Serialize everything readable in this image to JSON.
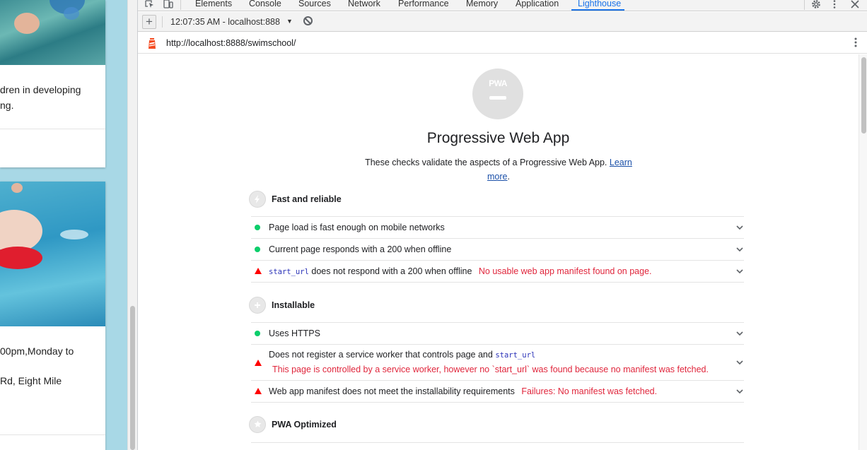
{
  "website": {
    "card1_lines": [
      "dren in developing",
      "ng."
    ],
    "card2_lines": [
      "00pm,Monday to",
      "Rd, Eight Mile"
    ]
  },
  "devtools": {
    "tabs": [
      "Elements",
      "Console",
      "Sources",
      "Network",
      "Performance",
      "Memory",
      "Application",
      "Lighthouse"
    ],
    "active_tab": "Lighthouse",
    "report_selector": "12:07:35 AM - localhost:888",
    "url": "http://localhost:8888/swimschool/"
  },
  "report": {
    "badge_text": "PWA",
    "title": "Progressive Web App",
    "description": "These checks validate the aspects of a Progressive Web App.",
    "learn_more": "Learn more",
    "groups": [
      {
        "title": "Fast and reliable",
        "audits": [
          {
            "status": "pass",
            "title": "Page load is fast enough on mobile networks"
          },
          {
            "status": "pass",
            "title": "Current page responds with a 200 when offline"
          },
          {
            "status": "fail",
            "code": "start_url",
            "title": "does not respond with a 200 when offline",
            "error": "No usable web app manifest found on page."
          }
        ]
      },
      {
        "title": "Installable",
        "audits": [
          {
            "status": "pass",
            "title": "Uses HTTPS"
          },
          {
            "status": "fail",
            "title": "Does not register a service worker that controls page and",
            "code": "start_url",
            "error": "This page is controlled by a service worker, however no `start_url` was found because no manifest was fetched."
          },
          {
            "status": "fail",
            "title": "Web app manifest does not meet the installability requirements",
            "error": "Failures: No manifest was fetched."
          }
        ]
      },
      {
        "title": "PWA Optimized"
      }
    ]
  },
  "colors": {
    "pass": "#0cce6b",
    "fail": "#ff0000",
    "error_text": "#e0263c",
    "accent": "#1a73e8",
    "site_background": "#a8d8e6"
  }
}
